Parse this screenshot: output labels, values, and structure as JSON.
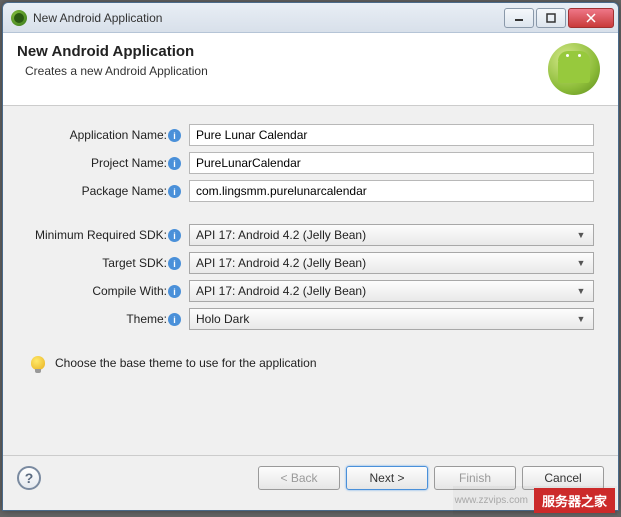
{
  "window": {
    "title": "New Android Application"
  },
  "banner": {
    "title": "New Android Application",
    "subtitle": "Creates a new Android Application"
  },
  "labels": {
    "app_name": "Application Name:",
    "project_name": "Project Name:",
    "package_name": "Package Name:",
    "min_sdk": "Minimum Required SDK:",
    "target_sdk": "Target SDK:",
    "compile_with": "Compile With:",
    "theme": "Theme:"
  },
  "fields": {
    "app_name": "Pure Lunar Calendar",
    "project_name": "PureLunarCalendar",
    "package_name": "com.lingsmm.purelunarcalendar",
    "min_sdk": "API 17: Android 4.2 (Jelly Bean)",
    "target_sdk": "API 17: Android 4.2 (Jelly Bean)",
    "compile_with": "API 17: Android 4.2 (Jelly Bean)",
    "theme": "Holo Dark"
  },
  "hint": "Choose the base theme to use for the application",
  "buttons": {
    "back": "< Back",
    "next": "Next >",
    "finish": "Finish",
    "cancel": "Cancel"
  },
  "watermark": {
    "url": "www.zzvips.com",
    "badge": "服务器之家"
  }
}
